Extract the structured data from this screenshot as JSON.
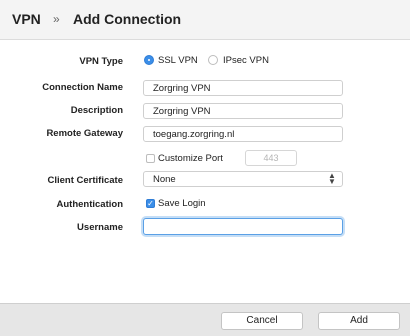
{
  "header": {
    "root": "VPN",
    "separator": "»",
    "title": "Add Connection"
  },
  "form": {
    "vpn_type": {
      "label": "VPN Type",
      "options": [
        "SSL VPN",
        "IPsec VPN"
      ],
      "selected": "SSL VPN"
    },
    "connection_name": {
      "label": "Connection Name",
      "value": "Zorgring VPN"
    },
    "description": {
      "label": "Description",
      "value": "Zorgring VPN"
    },
    "remote_gateway": {
      "label": "Remote Gateway",
      "value": "toegang.zorgring.nl"
    },
    "customize_port": {
      "label": "Customize Port",
      "checked": false,
      "port": "443"
    },
    "client_certificate": {
      "label": "Client Certificate",
      "value": "None"
    },
    "authentication": {
      "label": "Authentication",
      "option": "Save Login",
      "checked": true
    },
    "username": {
      "label": "Username",
      "value": ""
    }
  },
  "footer": {
    "cancel_label": "Cancel",
    "add_label": "Add"
  },
  "colors": {
    "accent": "#3b8ee8",
    "header_bg": "#f4f4f4",
    "footer_bg": "#e6e6e6"
  }
}
